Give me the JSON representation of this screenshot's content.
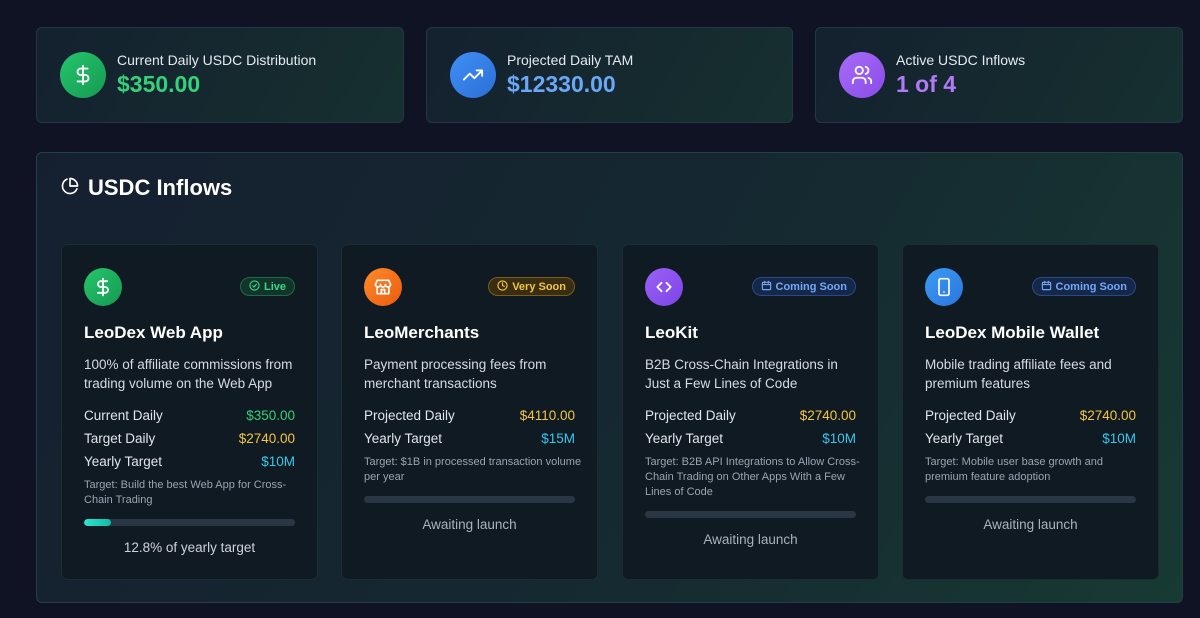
{
  "stats": [
    {
      "label": "Current Daily USDC Distribution",
      "value": "$350.00",
      "icon": "dollar-icon",
      "color": "#34d17a"
    },
    {
      "label": "Projected Daily TAM",
      "value": "$12330.00",
      "icon": "trending-up-icon",
      "color": "#6aa8f7"
    },
    {
      "label": "Active USDC Inflows",
      "value": "1 of 4",
      "icon": "users-icon",
      "color": "#b07cf5"
    }
  ],
  "panel": {
    "title": "USDC Inflows",
    "icon": "pie-chart-icon"
  },
  "cards": [
    {
      "icon": "dollar-icon",
      "badge": "Live",
      "badge_icon": "check-circle-icon",
      "title": "LeoDex Web App",
      "description": "100% of affiliate commissions from trading volume on the Web App",
      "metrics": [
        {
          "label": "Current Daily",
          "value": "$350.00"
        },
        {
          "label": "Target Daily",
          "value": "$2740.00"
        },
        {
          "label": "Yearly Target",
          "value": "$10M"
        }
      ],
      "target": "Target: Build the best Web App for Cross-Chain Trading",
      "progress_percent": 12.8,
      "footer": "12.8% of yearly target"
    },
    {
      "icon": "store-icon",
      "badge": "Very Soon",
      "badge_icon": "clock-icon",
      "title": "LeoMerchants",
      "description": "Payment processing fees from merchant transactions",
      "metrics": [
        {
          "label": "Projected Daily",
          "value": "$4110.00"
        },
        {
          "label": "Yearly Target",
          "value": "$15M"
        }
      ],
      "target": "Target: $1B in processed transaction volume per year",
      "progress_percent": 0,
      "footer": "Awaiting launch"
    },
    {
      "icon": "code-icon",
      "badge": "Coming Soon",
      "badge_icon": "calendar-icon",
      "title": "LeoKit",
      "description": "B2B Cross-Chain Integrations in Just a Few Lines of Code",
      "metrics": [
        {
          "label": "Projected Daily",
          "value": "$2740.00"
        },
        {
          "label": "Yearly Target",
          "value": "$10M"
        }
      ],
      "target": "Target: B2B API Integrations to Allow Cross-Chain Trading on Other Apps With a Few Lines of Code",
      "progress_percent": 0,
      "footer": "Awaiting launch"
    },
    {
      "icon": "smartphone-icon",
      "badge": "Coming Soon",
      "badge_icon": "calendar-icon",
      "title": "LeoDex Mobile Wallet",
      "description": "Mobile trading affiliate fees and premium features",
      "metrics": [
        {
          "label": "Projected Daily",
          "value": "$2740.00"
        },
        {
          "label": "Yearly Target",
          "value": "$10M"
        }
      ],
      "target": "Target: Mobile user base growth and premium feature adoption",
      "progress_percent": 0,
      "footer": "Awaiting launch"
    }
  ]
}
